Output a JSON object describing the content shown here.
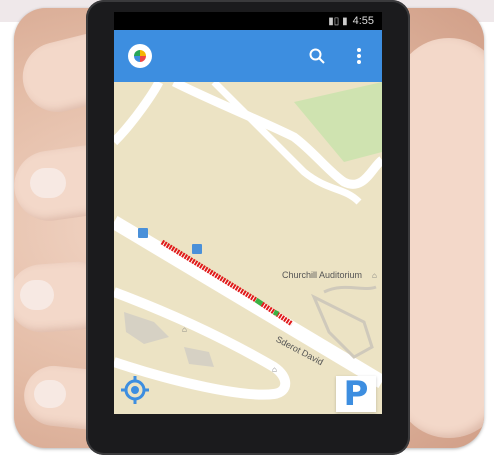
{
  "status_bar": {
    "time": "4:55"
  },
  "app_bar": {
    "logo_icon": "parking-logo-icon",
    "search_icon": "search-icon",
    "menu_icon": "more-vert-icon",
    "color": "#3d8ee0"
  },
  "map": {
    "labels": [
      {
        "text": "Churchill Auditorium"
      },
      {
        "text": "Sderot David"
      }
    ],
    "parking_segment_colors": {
      "occupied": "#e01a1a",
      "free": "#3cb043"
    }
  },
  "controls": {
    "locate_icon": "my-location-icon",
    "parking_button_label": "P"
  }
}
